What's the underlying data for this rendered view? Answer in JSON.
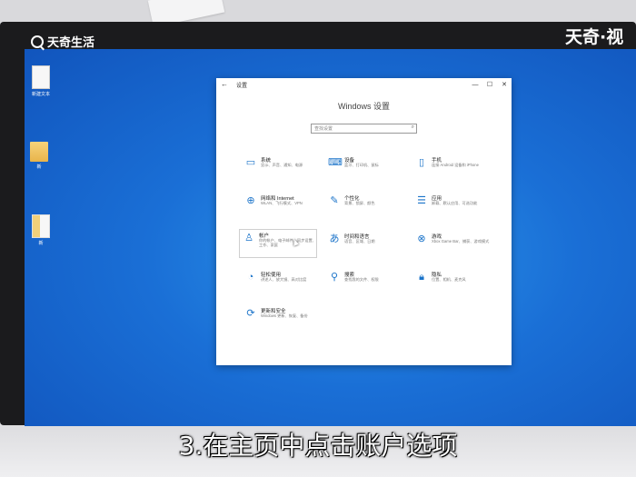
{
  "watermarks": {
    "left": "天奇生活",
    "right": "天奇·视"
  },
  "desktop": {
    "icons": [
      {
        "label": "新建文本",
        "kind": "file"
      },
      {
        "label": "新",
        "kind": "folder"
      },
      {
        "label": "新",
        "kind": "zip"
      }
    ]
  },
  "window": {
    "title": "设置",
    "back": "←",
    "controls": {
      "minimize": "—",
      "maximize": "☐",
      "close": "✕"
    },
    "heading": "Windows 设置",
    "search": {
      "placeholder": "查找设置",
      "icon": "search-icon"
    },
    "tiles": [
      {
        "name": "系统",
        "desc": "显示、声音、通知、电源",
        "icon": "laptop-icon"
      },
      {
        "name": "设备",
        "desc": "蓝牙、打印机、鼠标",
        "icon": "devices-icon"
      },
      {
        "name": "手机",
        "desc": "连接 Android 设备和 iPhone",
        "icon": "phone-icon"
      },
      {
        "name": "网络和 Internet",
        "desc": "WLAN、飞行模式、VPN",
        "icon": "globe-icon"
      },
      {
        "name": "个性化",
        "desc": "背景、锁屏、颜色",
        "icon": "paintbrush-icon"
      },
      {
        "name": "应用",
        "desc": "卸载、默认应用、可选功能",
        "icon": "apps-list-icon"
      },
      {
        "name": "帐户",
        "desc": "你的帐户、电子邮件、同步设置、工作、家庭",
        "icon": "person-icon"
      },
      {
        "name": "时间和语言",
        "desc": "语音、区域、日期",
        "icon": "time-language-icon"
      },
      {
        "name": "游戏",
        "desc": "Xbox Game Bar、捕获、游戏模式",
        "icon": "xbox-icon"
      },
      {
        "name": "轻松使用",
        "desc": "讲述人、放大镜、高对比度",
        "icon": "ease-of-access-icon"
      },
      {
        "name": "搜索",
        "desc": "查找我的文件、权限",
        "icon": "magnifier-icon"
      },
      {
        "name": "隐私",
        "desc": "位置、相机、麦克风",
        "icon": "lock-icon"
      },
      {
        "name": "更新和安全",
        "desc": "Windows 更新、恢复、备份",
        "icon": "sync-icon"
      }
    ]
  },
  "caption": "3.在主页中点击账户选项",
  "colors": {
    "accent": "#1a73c9",
    "desktop": "#1a6fd6",
    "bezel": "#1b1b1d"
  }
}
